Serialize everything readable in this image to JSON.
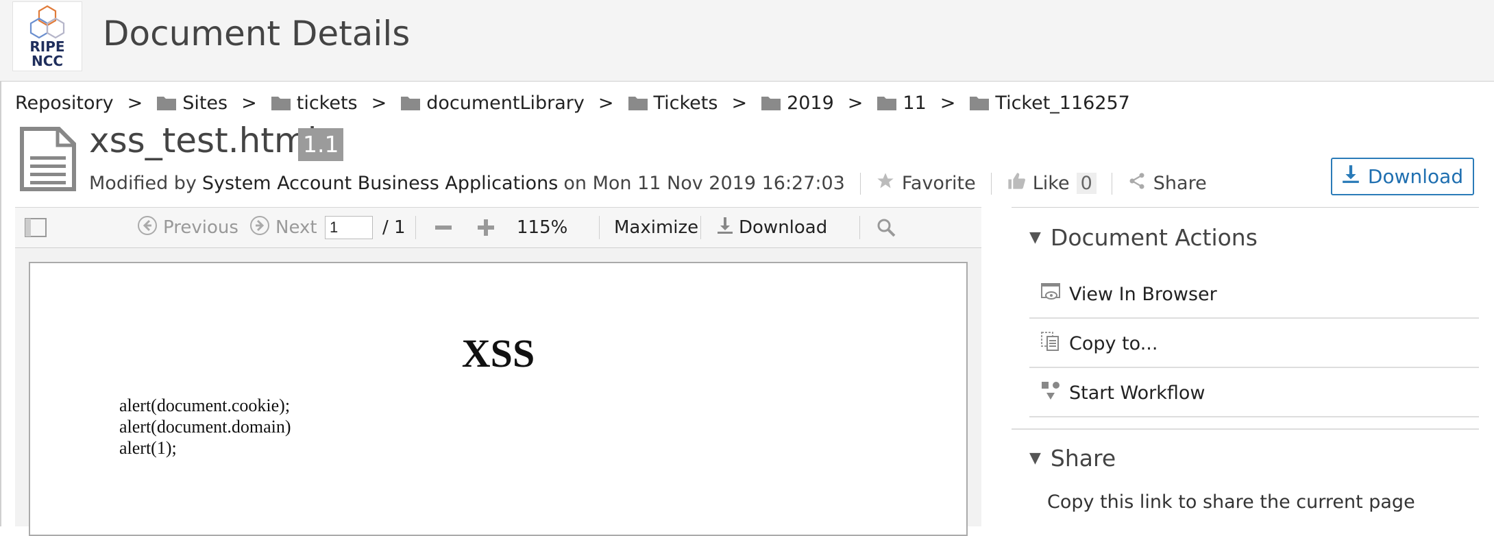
{
  "header": {
    "title": "Document Details",
    "logo": {
      "line1": "RIPE",
      "line2": "NCC"
    }
  },
  "breadcrumb": [
    {
      "label": "Repository",
      "icon": ""
    },
    {
      "label": "Sites",
      "icon": "folder-icon"
    },
    {
      "label": "tickets",
      "icon": "folder-icon"
    },
    {
      "label": "documentLibrary",
      "icon": "folder-icon"
    },
    {
      "label": "Tickets",
      "icon": "folder-icon"
    },
    {
      "label": "2019",
      "icon": "folder-icon"
    },
    {
      "label": "11",
      "icon": "folder-icon"
    },
    {
      "label": "Ticket_116257",
      "icon": "folder-icon"
    }
  ],
  "breadcrumb_separator": ">",
  "document": {
    "name": "xss_test.html",
    "version": "1.1",
    "modified_prefix": "Modified by",
    "modified_by": "System Account Business Applications",
    "modified_on": "on Mon 11 Nov 2019 16:27:03",
    "favorite_label": "Favorite",
    "like_label": "Like",
    "like_count": "0",
    "share_label": "Share",
    "download_label": "Download"
  },
  "viewer": {
    "previous_label": "Previous",
    "next_label": "Next",
    "page_value": "1",
    "page_total": "/ 1",
    "zoom": "115%",
    "maximize_label": "Maximize",
    "download_label": "Download",
    "content": {
      "heading": "XSS",
      "lines": [
        "alert(document.cookie);",
        "alert(document.domain)",
        "alert(1);"
      ]
    }
  },
  "panel": {
    "document_actions_title": "Document Actions",
    "actions": [
      "View In Browser",
      "Copy to...",
      "Start Workflow"
    ],
    "share_title": "Share",
    "share_text": "Copy this link to share the current page"
  },
  "colors": {
    "accent": "#2a7bb8",
    "folder": "#888888"
  }
}
